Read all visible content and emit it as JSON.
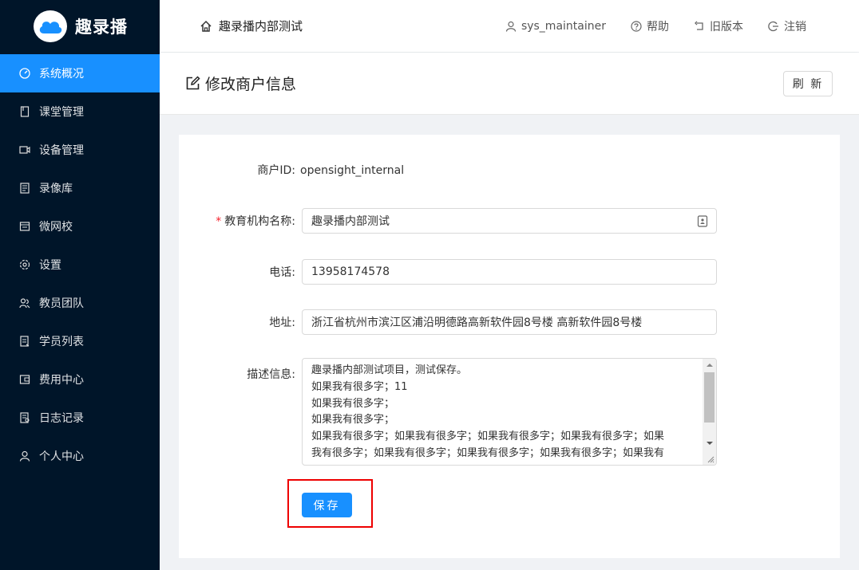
{
  "app": {
    "name": "趣录播"
  },
  "sidebar": {
    "items": [
      {
        "label": "系统概况",
        "icon": "dashboard-icon",
        "active": true
      },
      {
        "label": "课堂管理",
        "icon": "book-icon"
      },
      {
        "label": "设备管理",
        "icon": "video-camera-icon"
      },
      {
        "label": "录像库",
        "icon": "library-icon"
      },
      {
        "label": "微网校",
        "icon": "bank-icon"
      },
      {
        "label": "设置",
        "icon": "gear-icon"
      },
      {
        "label": "教员团队",
        "icon": "team-icon"
      },
      {
        "label": "学员列表",
        "icon": "list-icon"
      },
      {
        "label": "费用中心",
        "icon": "wallet-icon"
      },
      {
        "label": "日志记录",
        "icon": "log-icon"
      },
      {
        "label": "个人中心",
        "icon": "user-icon"
      }
    ]
  },
  "header": {
    "breadcrumb": "趣录播内部测试",
    "username": "sys_maintainer",
    "help": "帮助",
    "old_version": "旧版本",
    "logout": "注销"
  },
  "page": {
    "title": "修改商户信息",
    "refresh": "刷 新"
  },
  "form": {
    "merchant_id_label": "商户ID",
    "merchant_id_value": "opensight_internal",
    "org_name_label": "教育机构名称",
    "org_name_value": "趣录播内部测试",
    "phone_label": "电话",
    "phone_value": "13958174578",
    "address_label": "地址",
    "address_value": "浙江省杭州市滨江区浦沿明德路高新软件园8号楼 高新软件园8号楼",
    "description_label": "描述信息",
    "description_lines": [
      "趣录播内部测试项目，测试保存。",
      "如果我有很多字；11",
      "如果我有很多字；",
      "如果我有很多字；",
      "如果我有很多字；如果我有很多字；如果我有很多字；如果我有很多字；如果",
      "我有很多字；如果我有很多字；如果我有很多字；如果我有很多字；如果我有"
    ],
    "save": "保存"
  },
  "colors": {
    "sidebar_bg": "#001529",
    "accent": "#1890ff",
    "highlight_border": "#e00000"
  }
}
